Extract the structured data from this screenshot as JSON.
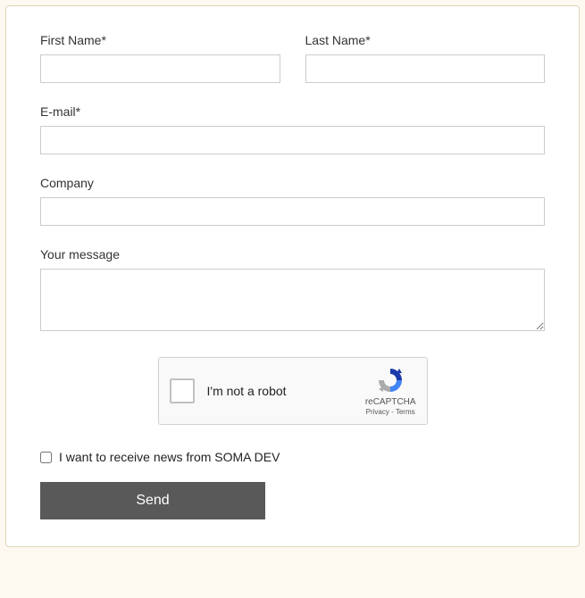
{
  "form": {
    "firstName": {
      "label": "First Name*",
      "value": ""
    },
    "lastName": {
      "label": "Last Name*",
      "value": ""
    },
    "email": {
      "label": "E-mail*",
      "value": ""
    },
    "company": {
      "label": "Company",
      "value": ""
    },
    "message": {
      "label": "Your message",
      "value": ""
    },
    "newsletter": {
      "label": "I want to receive news from SOMA DEV",
      "checked": false
    },
    "submit": {
      "label": "Send"
    }
  },
  "recaptcha": {
    "label": "I'm not a robot",
    "brand": "reCAPTCHA",
    "privacy": "Privacy",
    "separator": " - ",
    "terms": "Terms"
  }
}
